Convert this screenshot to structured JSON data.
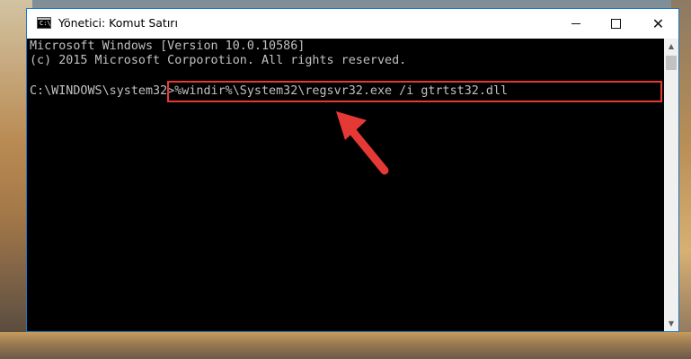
{
  "window": {
    "title": "Yönetici: Komut Satırı",
    "icon_text": "C:\\",
    "controls": {
      "minimize_icon": "minimize-icon",
      "maximize_icon": "maximize-icon",
      "close_glyph": "✕"
    }
  },
  "console": {
    "line1": "Microsoft Windows [Version 10.0.10586]",
    "line2": "(c) 2015 Microsoft Corporotion. All rights reserved.",
    "prompt": "C:\\WINDOWS\\system32>",
    "command": "%windir%\\System32\\regsvr32.exe /i gtrtst32.dll"
  },
  "scrollbar": {
    "up_glyph": "▲",
    "down_glyph": "▼"
  },
  "colors": {
    "highlight_border": "#e53935",
    "arrow": "#e53935",
    "console_text": "#c0c0c0",
    "window_border": "#1a78c8"
  }
}
